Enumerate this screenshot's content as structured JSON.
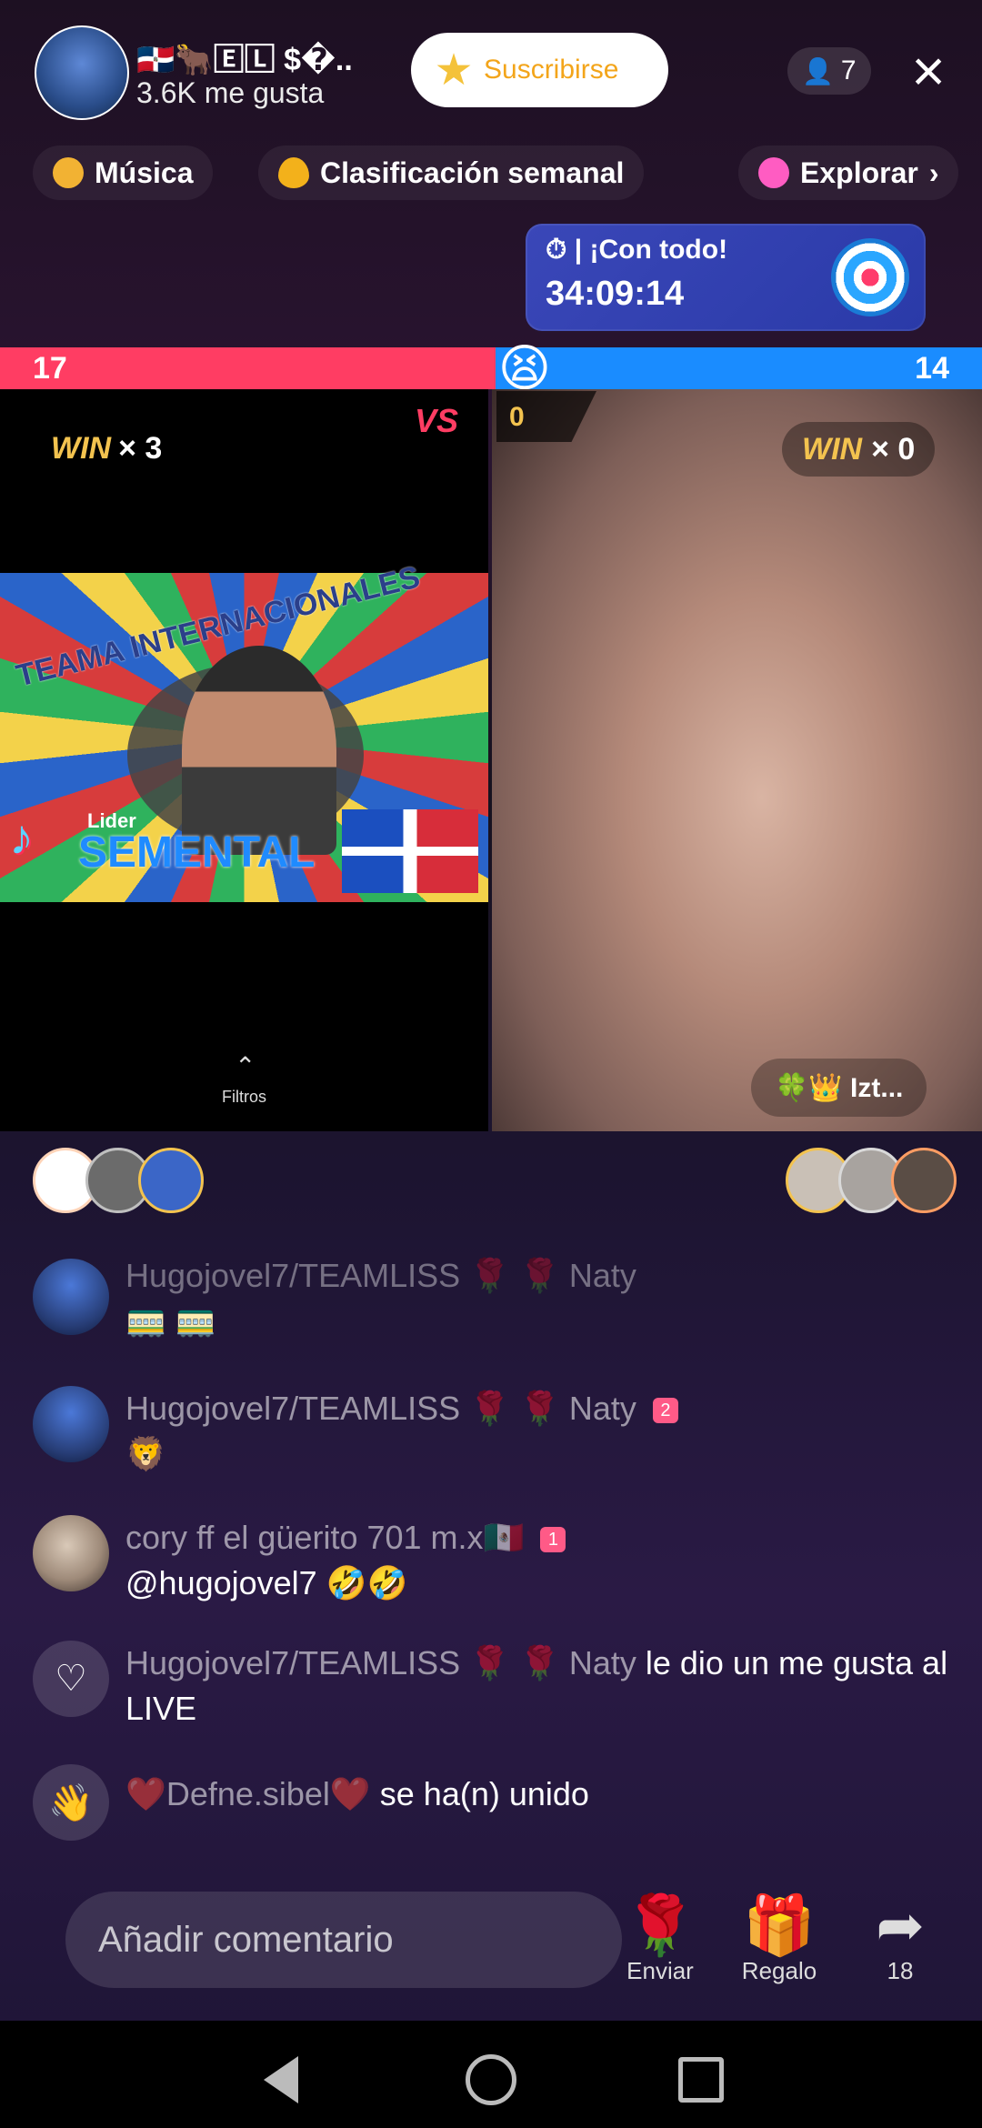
{
  "header": {
    "host_name": "🇩🇴🐂🄴🄻 $�..",
    "host_likes": "3.6K me gusta",
    "subscribe_label": "Suscribirse",
    "viewers": "7",
    "close_icon": "close-icon"
  },
  "chips": [
    {
      "label": "Música",
      "icon": "music-note-icon",
      "color": "#f2b233"
    },
    {
      "label": "Clasificación semanal",
      "icon": "flame-icon",
      "color": "#f3b11b"
    },
    {
      "label": "Explorar",
      "icon": "planet-icon",
      "color": "#ff5cc2"
    }
  ],
  "event": {
    "title": "⏱ | ¡Con todo!",
    "time": "34:09:14"
  },
  "battle": {
    "left_score": "17",
    "right_score": "14",
    "left_share": 0.505,
    "win_left_label": "WIN",
    "win_left_mult": "× 3",
    "win_right_label": "WIN",
    "win_right_mult": "× 0",
    "vs_label": "VS",
    "small_score": "0",
    "filters_label": "Filtros",
    "opponent_name": "🍀👑 Izt..."
  },
  "banner": {
    "title_text": "TEAMA INTERNACIONALES",
    "leader_label": "Lider",
    "brand_text": "SEMENTAL",
    "brand_icon": "tiktok-logo-icon"
  },
  "chat": [
    {
      "user": "Hugojovel7/TEAMLISS 🌹 🌹 Naty",
      "msg": "🚃 🚃"
    },
    {
      "user": "Hugojovel7/TEAMLISS 🌹 🌹 Naty",
      "badge": "2",
      "msg": "🦁"
    },
    {
      "user": "cory ff el güerito 701 m.x🇲🇽",
      "badge": "1",
      "msg": "@hugojovel7 🤣🤣"
    },
    {
      "user": "Hugojovel7/TEAMLISS 🌹 🌹 Naty",
      "action": " le dio un me gusta al LIVE"
    },
    {
      "user": "❤️Defne.sibel❤️",
      "action": " se ha(n) unido"
    }
  ],
  "bottom": {
    "comment_placeholder": "Añadir comentario",
    "send_label": "Enviar",
    "gift_label": "Regalo",
    "share_count": "18"
  },
  "colors": {
    "red": "#ff3d63",
    "blue": "#1a8cff",
    "gold": "#f3c34f"
  }
}
